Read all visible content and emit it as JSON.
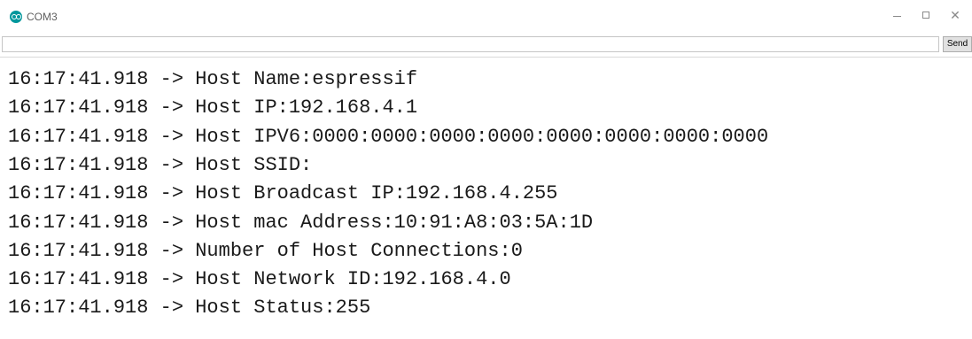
{
  "window": {
    "title": "COM3",
    "icon": "arduino-icon",
    "controls": [
      "minimize-icon",
      "maximize-icon",
      "close-icon"
    ]
  },
  "input": {
    "value": "",
    "placeholder": ""
  },
  "send_button": {
    "label": "Send"
  },
  "log": {
    "lines": [
      "16:17:41.918 -> Host Name:espressif",
      "16:17:41.918 -> Host IP:192.168.4.1",
      "16:17:41.918 -> Host IPV6:0000:0000:0000:0000:0000:0000:0000:0000",
      "16:17:41.918 -> Host SSID:",
      "16:17:41.918 -> Host Broadcast IP:192.168.4.255",
      "16:17:41.918 -> Host mac Address:10:91:A8:03:5A:1D",
      "16:17:41.918 -> Number of Host Connections:0",
      "16:17:41.918 -> Host Network ID:192.168.4.0",
      "16:17:41.918 -> Host Status:255"
    ]
  },
  "colors": {
    "icon": "#00979c",
    "text": "#1a1a1a",
    "title": "#5f5f5f"
  }
}
